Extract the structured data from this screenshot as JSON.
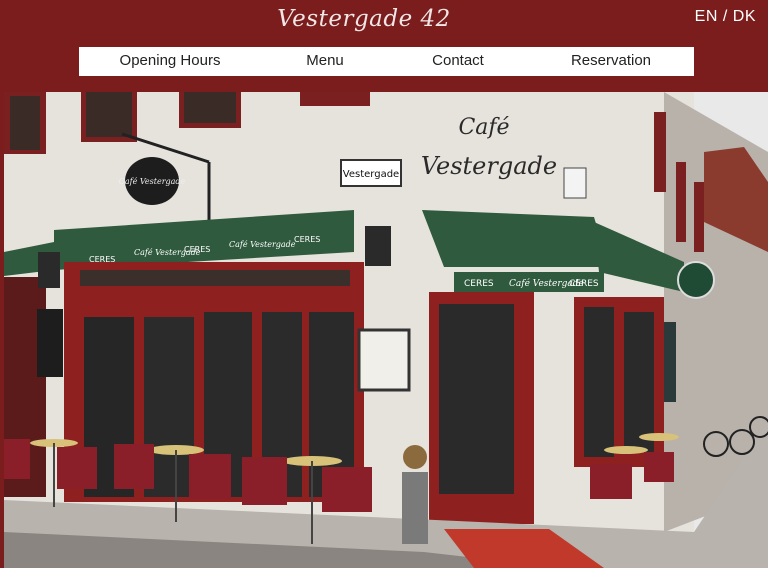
{
  "header": {
    "title": "Vestergade 42",
    "lang": {
      "en": "EN",
      "separator": "/",
      "dk": "DK"
    }
  },
  "nav": {
    "items": [
      "Opening Hours",
      "Menu",
      "Contact",
      "Reservation"
    ]
  },
  "photo": {
    "street_sign": "Vestergade",
    "wall_lettering": [
      "Café",
      "Vestergade"
    ],
    "awning_brand": "CERES",
    "awning_script": "Café Vestergade"
  },
  "colors": {
    "brand": "#7c1d1d",
    "nav_bg": "#ffffff",
    "awning": "#2f5a3e",
    "door_frame": "#8f2020"
  }
}
